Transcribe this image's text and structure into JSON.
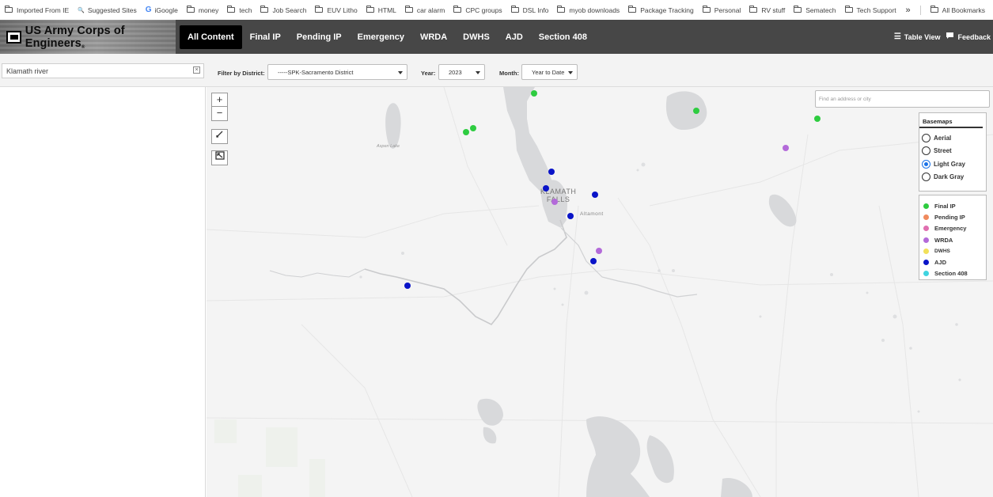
{
  "bookmarks": {
    "items": [
      {
        "label": "Imported From IE",
        "icon": "folder-icon"
      },
      {
        "label": "Suggested Sites",
        "icon": "search-icon"
      },
      {
        "label": "iGoogle",
        "icon": "google-icon"
      },
      {
        "label": "money",
        "icon": "folder-icon"
      },
      {
        "label": "tech",
        "icon": "folder-icon"
      },
      {
        "label": "Job Search",
        "icon": "folder-icon"
      },
      {
        "label": "EUV Litho",
        "icon": "folder-icon"
      },
      {
        "label": "HTML",
        "icon": "folder-icon"
      },
      {
        "label": "car alarm",
        "icon": "folder-icon"
      },
      {
        "label": "CPC groups",
        "icon": "folder-icon"
      },
      {
        "label": "DSL Info",
        "icon": "folder-icon"
      },
      {
        "label": "myob downloads",
        "icon": "folder-icon"
      },
      {
        "label": "Package Tracking",
        "icon": "folder-icon"
      },
      {
        "label": "Personal",
        "icon": "folder-icon"
      },
      {
        "label": "RV stuff",
        "icon": "folder-icon"
      },
      {
        "label": "Sematech",
        "icon": "folder-icon"
      },
      {
        "label": "Tech Support",
        "icon": "folder-icon"
      }
    ],
    "overflow": "»",
    "all_bookmarks": "All Bookmarks"
  },
  "header": {
    "logo_text": "US Army Corps of Engineers",
    "logo_mark": "®",
    "tabs": [
      {
        "label": "All Content",
        "active": true
      },
      {
        "label": "Final IP",
        "active": false
      },
      {
        "label": "Pending IP",
        "active": false
      },
      {
        "label": "Emergency",
        "active": false
      },
      {
        "label": "WRDA",
        "active": false
      },
      {
        "label": "DWHS",
        "active": false
      },
      {
        "label": "AJD",
        "active": false
      },
      {
        "label": "Section 408",
        "active": false
      }
    ],
    "table_view": "Table View",
    "feedback": "Feedback"
  },
  "filters": {
    "search_value": "Klamath river",
    "clear_glyph": "×",
    "district_label": "Filter by District:",
    "district_value": "-----SPK-Sacramento District",
    "year_label": "Year:",
    "year_value": "2023",
    "month_label": "Month:",
    "month_value": "Year to Date"
  },
  "map": {
    "zoom_in": "+",
    "zoom_out": "−",
    "address_placeholder": "Find an address or city",
    "city_label_line1": "KLAMATH",
    "city_label_line2": "FALLS",
    "altamont_label": "Altamont",
    "lake_label": "Aspen Lake",
    "basemaps_title": "Basemaps",
    "basemaps": [
      {
        "label": "Aerial",
        "selected": false
      },
      {
        "label": "Street",
        "selected": false
      },
      {
        "label": "Light Gray",
        "selected": true
      },
      {
        "label": "Dark Gray",
        "selected": false
      }
    ],
    "legend": [
      {
        "label": "Final IP",
        "color": "#2ecc40"
      },
      {
        "label": "Pending IP",
        "color": "#f08a5d"
      },
      {
        "label": "Emergency",
        "color": "#e06fb0"
      },
      {
        "label": "WRDA",
        "color": "#b36ad9"
      },
      {
        "label": "DWHS",
        "color": "#f1e05a"
      },
      {
        "label": "AJD",
        "color": "#0a14c8"
      },
      {
        "label": "Section 408",
        "color": "#3fd4e0"
      }
    ]
  }
}
